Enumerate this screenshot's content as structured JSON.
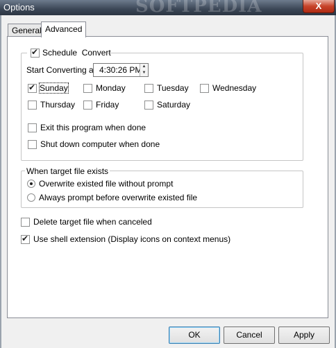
{
  "window": {
    "title": "Options",
    "watermark": "SOFTPEDIA",
    "close_glyph": "X"
  },
  "tabs": [
    {
      "label": "General"
    },
    {
      "label": "Advanced"
    }
  ],
  "schedule": {
    "label": "Schedule  Convert",
    "checked": true,
    "start_label": "Start Converting at:",
    "time_value": "4:30:26 PM",
    "days": [
      {
        "label": "Sunday",
        "checked": true
      },
      {
        "label": "Monday",
        "checked": false
      },
      {
        "label": "Tuesday",
        "checked": false
      },
      {
        "label": "Wednesday",
        "checked": false
      },
      {
        "label": "Thursday",
        "checked": false
      },
      {
        "label": "Friday",
        "checked": false
      },
      {
        "label": "Saturday",
        "checked": false
      }
    ],
    "exit_label": "Exit this program when done",
    "shutdown_label": "Shut down computer when done"
  },
  "target_exists": {
    "legend": "When target file exists",
    "options": [
      {
        "label": "Overwrite existed file without prompt",
        "selected": true
      },
      {
        "label": "Always prompt before overwrite existed file",
        "selected": false
      }
    ]
  },
  "delete_target_label": "Delete target file when canceled",
  "shell_extension_label": "Use shell extension (Display icons on context menus)",
  "buttons": {
    "ok": "OK",
    "cancel": "Cancel",
    "apply": "Apply"
  }
}
